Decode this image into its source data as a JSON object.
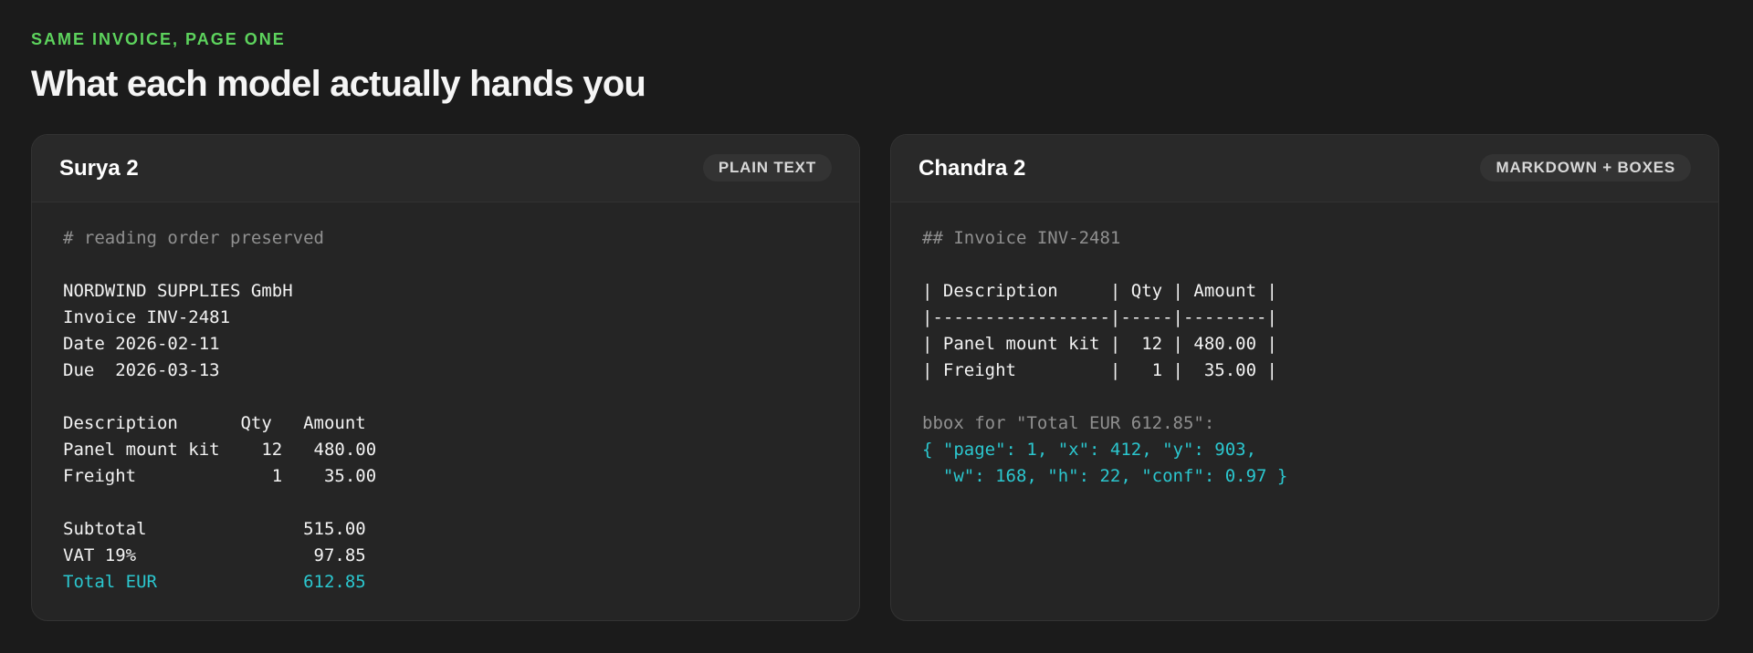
{
  "header": {
    "eyebrow": "SAME INVOICE, PAGE ONE",
    "title": "What each model actually hands you"
  },
  "colors": {
    "background": "#1b1b1b",
    "card": "#252525",
    "eyebrow": "#5dd35d",
    "accent": "#2bc7cf",
    "comment": "#909090"
  },
  "cards": [
    {
      "title": "Surya 2",
      "badge": "PLAIN TEXT",
      "lines": [
        {
          "text": "# reading order preserved",
          "style": "comment"
        },
        {
          "text": "",
          "style": "plain"
        },
        {
          "text": "NORDWIND SUPPLIES GmbH",
          "style": "plain"
        },
        {
          "text": "Invoice INV-2481",
          "style": "plain"
        },
        {
          "text": "Date 2026-02-11",
          "style": "plain"
        },
        {
          "text": "Due  2026-03-13",
          "style": "plain"
        },
        {
          "text": "",
          "style": "plain"
        },
        {
          "text": "Description      Qty   Amount",
          "style": "plain"
        },
        {
          "text": "Panel mount kit    12   480.00",
          "style": "plain"
        },
        {
          "text": "Freight             1    35.00",
          "style": "plain"
        },
        {
          "text": "",
          "style": "plain"
        },
        {
          "text": "Subtotal               515.00",
          "style": "plain"
        },
        {
          "text": "VAT 19%                 97.85",
          "style": "plain"
        },
        {
          "text": "Total EUR              612.85",
          "style": "accent"
        }
      ]
    },
    {
      "title": "Chandra 2",
      "badge": "MARKDOWN + BOXES",
      "lines": [
        {
          "text": "## Invoice INV-2481",
          "style": "comment"
        },
        {
          "text": "",
          "style": "plain"
        },
        {
          "text": "| Description     | Qty | Amount |",
          "style": "plain"
        },
        {
          "text": "|-----------------|-----|--------|",
          "style": "plain"
        },
        {
          "text": "| Panel mount kit |  12 | 480.00 |",
          "style": "plain"
        },
        {
          "text": "| Freight         |   1 |  35.00 |",
          "style": "plain"
        },
        {
          "text": "",
          "style": "plain"
        },
        {
          "text": "bbox for \"Total EUR 612.85\":",
          "style": "comment"
        },
        {
          "text": "{ \"page\": 1, \"x\": 412, \"y\": 903,",
          "style": "accent"
        },
        {
          "text": "  \"w\": 168, \"h\": 22, \"conf\": 0.97 }",
          "style": "accent"
        }
      ]
    }
  ]
}
